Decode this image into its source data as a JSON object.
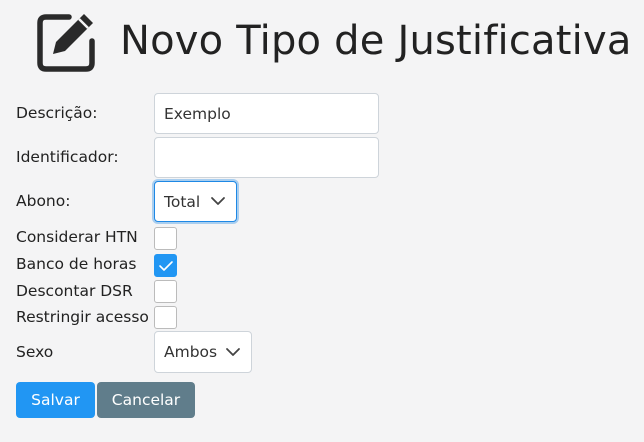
{
  "page": {
    "title": "Novo Tipo de Justificativa",
    "icon": "edit-icon"
  },
  "form": {
    "descricao": {
      "label": "Descrição:",
      "value": "Exemplo",
      "placeholder": ""
    },
    "identificador": {
      "label": "Identificador:",
      "value": "",
      "placeholder": ""
    },
    "abono": {
      "label": "Abono:",
      "selected": "Total",
      "icon": "chevron-down-icon"
    },
    "considerar_htn": {
      "label": "Considerar HTN",
      "checked": false
    },
    "banco_de_horas": {
      "label": "Banco de horas",
      "checked": true,
      "icon": "check-icon"
    },
    "descontar_dsr": {
      "label": "Descontar DSR",
      "checked": false
    },
    "restringir_acesso": {
      "label": "Restringir acesso",
      "checked": false
    },
    "sexo": {
      "label": "Sexo",
      "selected": "Ambos",
      "icon": "chevron-down-icon"
    }
  },
  "actions": {
    "save_label": "Salvar",
    "cancel_label": "Cancelar"
  },
  "colors": {
    "primary": "#2196f3",
    "secondary": "#607d8b",
    "focus": "#1e88e5",
    "background": "#f4f4f5"
  }
}
